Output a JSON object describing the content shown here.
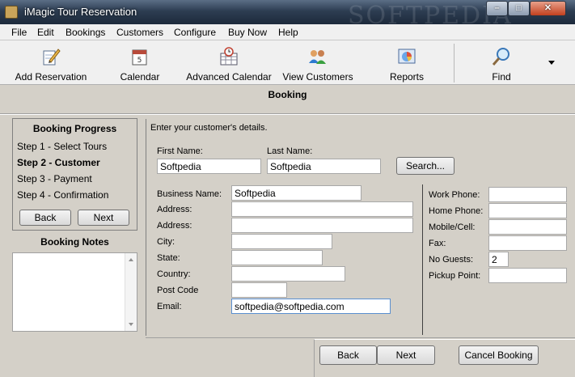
{
  "window": {
    "title": "iMagic Tour Reservation",
    "watermark": "SOFTPEDIA",
    "controls": {
      "minimize": "–",
      "maximize": "□",
      "close": "✕"
    }
  },
  "menu": [
    "File",
    "Edit",
    "Bookings",
    "Customers",
    "Configure",
    "Buy Now",
    "Help"
  ],
  "toolbar": {
    "add_reservation": "Add Reservation",
    "calendar": "Calendar",
    "advanced_calendar": "Advanced Calendar",
    "view_customers": "View Customers",
    "reports": "Reports",
    "find": "Find",
    "calendar_day": "5",
    "icons": {
      "add_reservation": "pencil-paper-icon",
      "calendar": "calendar-icon",
      "advanced_calendar": "advanced-calendar-icon",
      "view_customers": "people-icon",
      "reports": "chart-icon",
      "find": "magnifier-icon"
    }
  },
  "section_title": "Booking",
  "progress": {
    "title": "Booking Progress",
    "steps": [
      "Step 1 - Select Tours",
      "Step 2 - Customer",
      "Step 3 - Payment",
      "Step 4 - Confirmation"
    ],
    "active_step": 1,
    "back": "Back",
    "next": "Next"
  },
  "notes": {
    "title": "Booking Notes",
    "value": ""
  },
  "form": {
    "instructions": "Enter your customer's details.",
    "first_name": {
      "label": "First Name:",
      "value": "Softpedia"
    },
    "last_name": {
      "label": "Last Name:",
      "value": "Softpedia"
    },
    "search": "Search...",
    "business_name": {
      "label": "Business Name:",
      "value": "Softpedia"
    },
    "address1": {
      "label": "Address:",
      "value": ""
    },
    "address2": {
      "label": "Address:",
      "value": ""
    },
    "city": {
      "label": "City:",
      "value": ""
    },
    "state": {
      "label": "State:",
      "value": ""
    },
    "country": {
      "label": "Country:",
      "value": ""
    },
    "post_code": {
      "label": "Post Code",
      "value": ""
    },
    "email": {
      "label": "Email:",
      "value": "softpedia@softpedia.com"
    },
    "work_phone": {
      "label": "Work Phone:",
      "value": ""
    },
    "home_phone": {
      "label": "Home Phone:",
      "value": ""
    },
    "mobile": {
      "label": "Mobile/Cell:",
      "value": ""
    },
    "fax": {
      "label": "Fax:",
      "value": ""
    },
    "no_guests": {
      "label": "No Guests:",
      "value": "2"
    },
    "pickup_point": {
      "label": "Pickup Point:",
      "value": ""
    }
  },
  "footer": {
    "back": "Back",
    "next": "Next",
    "cancel": "Cancel Booking"
  },
  "colors": {
    "titlebar": "#2d3d52",
    "panel": "#d4d0c8",
    "toolbar": "#f0f0f0",
    "focus_border": "#5a8fd0"
  }
}
